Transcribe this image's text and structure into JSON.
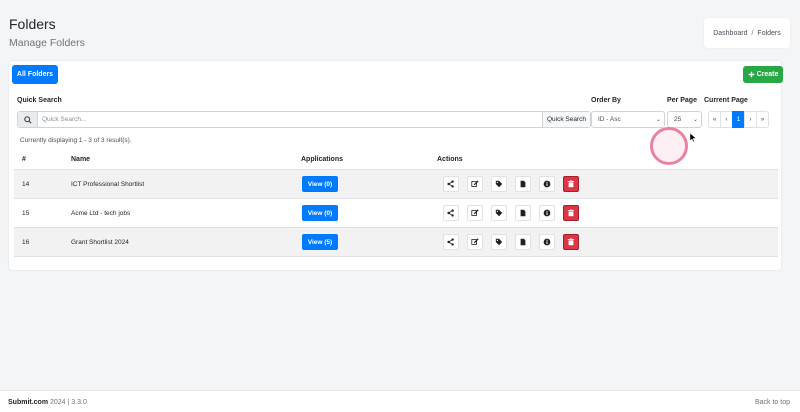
{
  "header": {
    "title": "Folders",
    "subtitle": "Manage Folders",
    "breadcrumb": [
      "Dashboard",
      "Folders"
    ],
    "breadcrumb_separator": "/"
  },
  "toolbar": {
    "all_folders_label": "All Folders",
    "create_label": "Create",
    "create_icon": "plus-icon"
  },
  "filters": {
    "quick_search_label": "Quick Search",
    "search_placeholder": "Quick Search...",
    "search_button": "Quick Search",
    "order_by_label": "Order By",
    "order_by_value": "ID - Asc",
    "per_page_label": "Per Page",
    "per_page_value": "25",
    "current_page_label": "Current Page",
    "pager": [
      "«",
      "‹",
      "1",
      "›",
      "»"
    ],
    "active_page": "1"
  },
  "results_text": "Currently displaying 1 - 3 of 3 result(s).",
  "table": {
    "columns": [
      "#",
      "Name",
      "Applications",
      "Actions"
    ],
    "rows": [
      {
        "id": "14",
        "name": "ICT Professional Shortlist",
        "applications": "View (0)"
      },
      {
        "id": "15",
        "name": "Acme Ltd - tech jobs",
        "applications": "View (0)"
      },
      {
        "id": "16",
        "name": "Grant Shortlist 2024",
        "applications": "View (5)"
      }
    ],
    "action_icons": [
      "share-icon",
      "edit-icon",
      "tag-icon",
      "file-icon",
      "info-icon",
      "trash-icon"
    ]
  },
  "footer": {
    "brand": "Submit.com",
    "version_text": " 2024 | 3.3.0",
    "back_to_top": "Back to top"
  },
  "colors": {
    "primary": "#007bff",
    "success": "#28a745",
    "danger": "#dc3545",
    "background": "#f4f5f7"
  }
}
